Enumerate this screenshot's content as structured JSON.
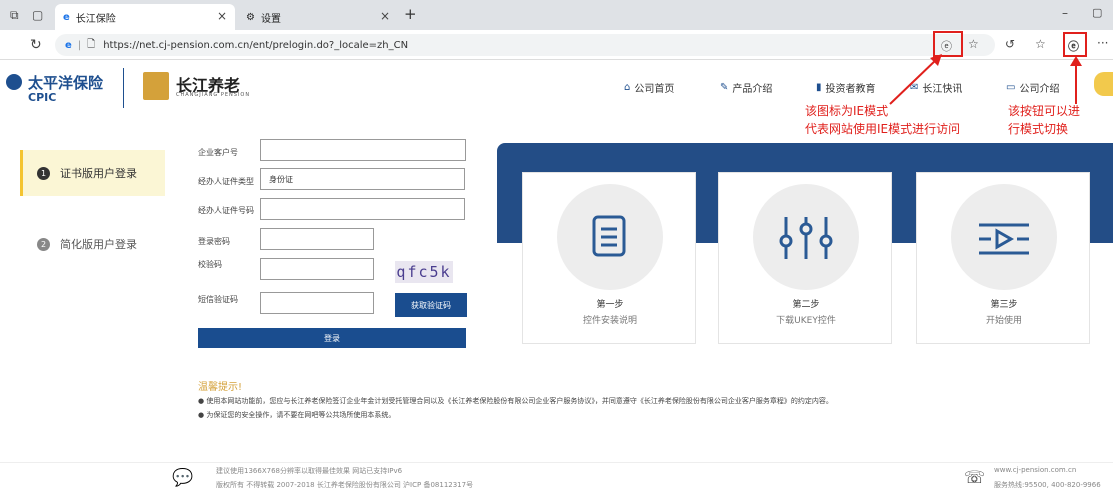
{
  "browser": {
    "tabs": [
      {
        "title": "长江保险"
      },
      {
        "title": "设置"
      }
    ],
    "new_tab_label": "+",
    "url": "https://net.cj-pension.com.cn/ent/prelogin.do?_locale=zh_CN"
  },
  "site": {
    "logo_cpic_cn": "太平洋保险",
    "logo_cpic_en": "CPIC",
    "logo_cj_cn": "长江养老",
    "logo_cj_en": "CHANGJIANG PENSION",
    "nav": [
      {
        "label": "公司首页",
        "icon": "home-icon"
      },
      {
        "label": "产品介绍",
        "icon": "edit-icon"
      },
      {
        "label": "投资者教育",
        "icon": "chart-icon"
      },
      {
        "label": "长江快讯",
        "icon": "mail-icon"
      },
      {
        "label": "公司介绍",
        "icon": "monitor-icon"
      }
    ]
  },
  "annotations": {
    "ie_icon_line1": "该图标为IE模式",
    "ie_icon_line2": "代表网站使用IE模式进行访问",
    "toggle_line1": "该按钮可以进",
    "toggle_line2": "行模式切换"
  },
  "sidebar": {
    "items": [
      {
        "num": "1",
        "label": "证书版用户登录"
      },
      {
        "num": "2",
        "label": "简化版用户登录"
      }
    ]
  },
  "form": {
    "customer_no_label": "企业客户号",
    "id_type_label": "经办人证件类型",
    "id_type_value": "身份证",
    "id_no_label": "经办人证件号码",
    "password_label": "登录密码",
    "captcha_label": "校验码",
    "captcha_text": "qfc5k",
    "sms_label": "短信验证码",
    "sms_button": "获取验证码",
    "login_button": "登录"
  },
  "steps": [
    {
      "title": "第一步",
      "desc": "控件安装说明",
      "icon": "document-icon"
    },
    {
      "title": "第二步",
      "desc": "下载UKEY控件",
      "icon": "sliders-icon"
    },
    {
      "title": "第三步",
      "desc": "开始使用",
      "icon": "play-list-icon"
    }
  ],
  "tips": {
    "title": "温馨提示!",
    "line1": "● 使用本网站功能前，您应与长江养老保险签订企业年金计划受托管理合同以及《长江养老保险股份有限公司企业客户服务协议》，并同意遵守《长江养老保险股份有限公司企业客户服务章程》的约定内容。",
    "line2": "● 为保证您的安全操作，请不要在网吧等公共场所使用本系统。"
  },
  "footer": {
    "line1": "建议使用1366X768分辨率以取得最佳效果    网站已支持IPv6",
    "line2": "版权所有 不得转载 2007-2018 长江养老保险股份有限公司 沪ICP 备08112317号",
    "site": "www.cj-pension.com.cn",
    "hotline": "服务热线:95500, 400-820-9966"
  },
  "colors": {
    "brand_blue": "#1a4d8f",
    "annotation_red": "#e0201c",
    "active_tab_yellow": "#f4c430"
  }
}
